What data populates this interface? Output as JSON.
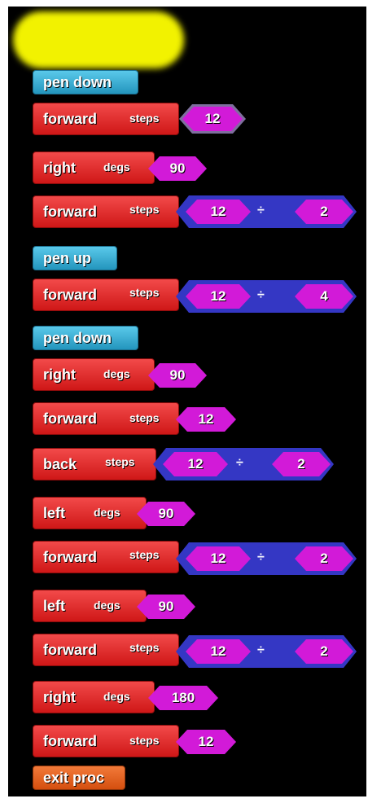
{
  "hat_block": {
    "label": ""
  },
  "blocks": [
    {
      "cmd": "pen down",
      "type": "pen"
    },
    {
      "cmd": "forward",
      "param": "steps",
      "value": "12"
    },
    {
      "cmd": "right",
      "param": "degs",
      "value": "90"
    },
    {
      "cmd": "forward",
      "param": "steps",
      "left": "12",
      "op": "÷",
      "right": "2"
    },
    {
      "cmd": "pen up",
      "type": "pen"
    },
    {
      "cmd": "forward",
      "param": "steps",
      "left": "12",
      "op": "÷",
      "right": "4"
    },
    {
      "cmd": "pen down",
      "type": "pen"
    },
    {
      "cmd": "right",
      "param": "degs",
      "value": "90"
    },
    {
      "cmd": "forward",
      "param": "steps",
      "value": "12"
    },
    {
      "cmd": "back",
      "param": "steps",
      "left": "12",
      "op": "÷",
      "right": "2"
    },
    {
      "cmd": "left",
      "param": "degs",
      "value": "90"
    },
    {
      "cmd": "forward",
      "param": "steps",
      "left": "12",
      "op": "÷",
      "right": "2"
    },
    {
      "cmd": "left",
      "param": "degs",
      "value": "90"
    },
    {
      "cmd": "forward",
      "param": "steps",
      "left": "12",
      "op": "÷",
      "right": "2"
    },
    {
      "cmd": "right",
      "param": "degs",
      "value": "180"
    },
    {
      "cmd": "forward",
      "param": "steps",
      "value": "12"
    },
    {
      "cmd": "exit proc",
      "type": "exit"
    }
  ],
  "colors": {
    "motion": "#e12a2a",
    "pen": "#35a9d3",
    "control": "#e86422",
    "value": "#d21ad8",
    "operator": "#3437c4",
    "background": "#000000"
  }
}
